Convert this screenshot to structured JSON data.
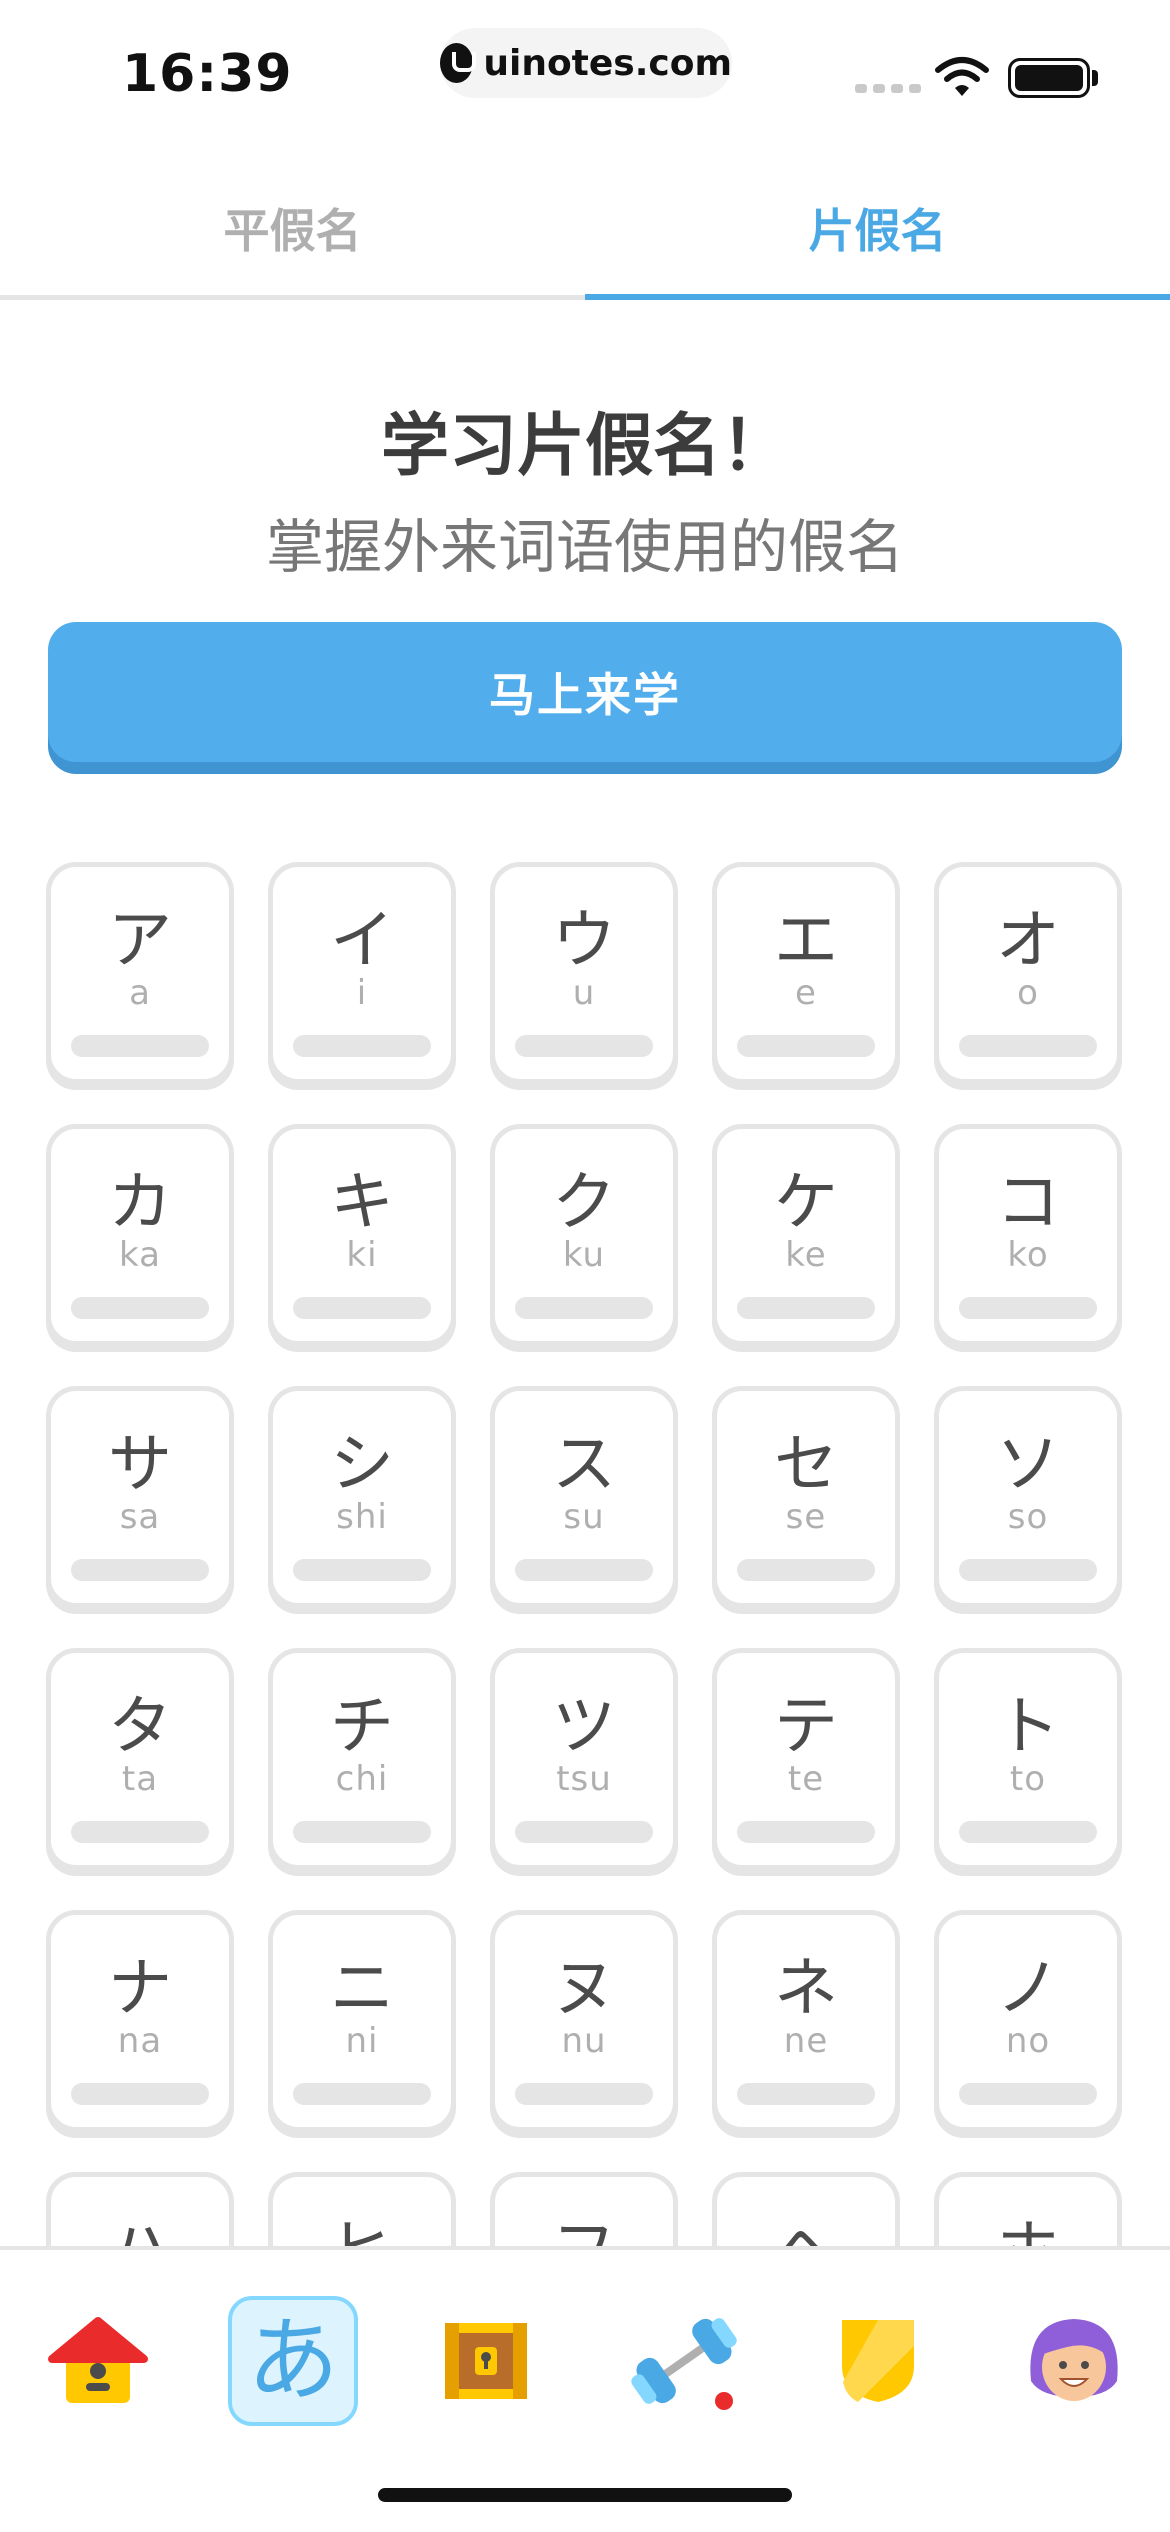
{
  "status_bar": {
    "time": "16:39",
    "url": "uinotes.com"
  },
  "tabs": [
    {
      "label": "平假名",
      "active": false
    },
    {
      "label": "片假名",
      "active": true
    }
  ],
  "hero": {
    "title": "学习片假名！",
    "subtitle": "掌握外来词语使用的假名",
    "cta_label": "马上来学"
  },
  "kana": [
    {
      "kana": "ア",
      "romaji": "a"
    },
    {
      "kana": "イ",
      "romaji": "i"
    },
    {
      "kana": "ウ",
      "romaji": "u"
    },
    {
      "kana": "エ",
      "romaji": "e"
    },
    {
      "kana": "オ",
      "romaji": "o"
    },
    {
      "kana": "カ",
      "romaji": "ka"
    },
    {
      "kana": "キ",
      "romaji": "ki"
    },
    {
      "kana": "ク",
      "romaji": "ku"
    },
    {
      "kana": "ケ",
      "romaji": "ke"
    },
    {
      "kana": "コ",
      "romaji": "ko"
    },
    {
      "kana": "サ",
      "romaji": "sa"
    },
    {
      "kana": "シ",
      "romaji": "shi"
    },
    {
      "kana": "ス",
      "romaji": "su"
    },
    {
      "kana": "セ",
      "romaji": "se"
    },
    {
      "kana": "ソ",
      "romaji": "so"
    },
    {
      "kana": "タ",
      "romaji": "ta"
    },
    {
      "kana": "チ",
      "romaji": "chi"
    },
    {
      "kana": "ツ",
      "romaji": "tsu"
    },
    {
      "kana": "テ",
      "romaji": "te"
    },
    {
      "kana": "ト",
      "romaji": "to"
    },
    {
      "kana": "ナ",
      "romaji": "na"
    },
    {
      "kana": "ニ",
      "romaji": "ni"
    },
    {
      "kana": "ヌ",
      "romaji": "nu"
    },
    {
      "kana": "ネ",
      "romaji": "ne"
    },
    {
      "kana": "ノ",
      "romaji": "no"
    },
    {
      "kana": "ハ",
      "romaji": ""
    },
    {
      "kana": "ヒ",
      "romaji": ""
    },
    {
      "kana": "フ",
      "romaji": ""
    },
    {
      "kana": "ヘ",
      "romaji": ""
    },
    {
      "kana": "ホ",
      "romaji": ""
    }
  ],
  "bottom_nav": [
    {
      "icon": "home-icon",
      "active": false
    },
    {
      "icon": "kana-icon",
      "glyph": "あ",
      "active": true
    },
    {
      "icon": "treasure-chest-icon",
      "active": false
    },
    {
      "icon": "dumbbell-icon",
      "active": false
    },
    {
      "icon": "shield-icon",
      "active": false
    },
    {
      "icon": "avatar-icon",
      "active": false
    }
  ],
  "colors": {
    "accent": "#4aa8e4",
    "cta": "#52adec",
    "card_border": "#e5e5e5",
    "muted": "#afafaf"
  }
}
